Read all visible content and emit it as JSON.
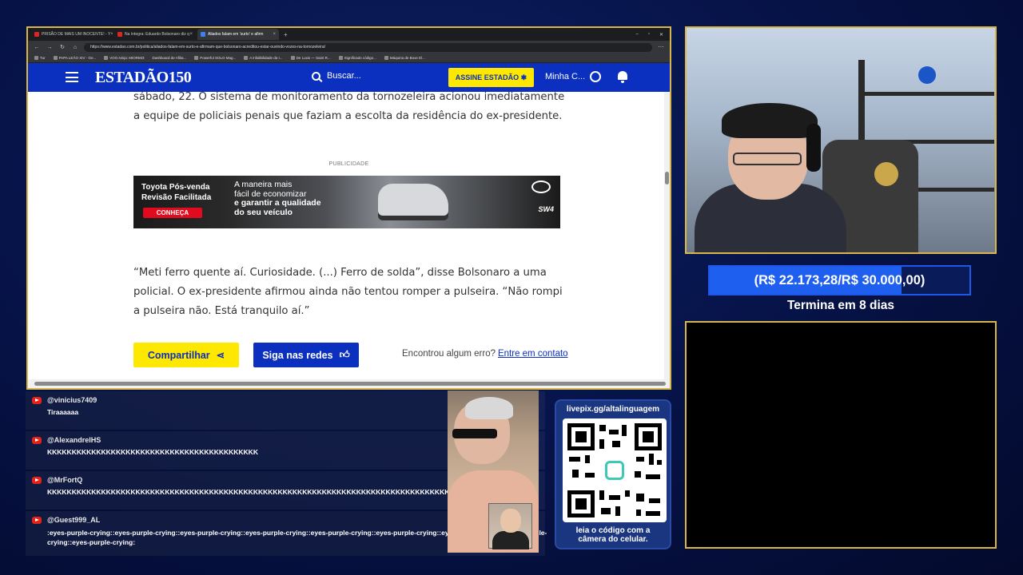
{
  "browser": {
    "tabs": [
      {
        "label": "PRISÃO DE MAIS UM INOCENTE! - Y"
      },
      {
        "label": "Na íntegra: Eduardo Bolsonaro diz q"
      },
      {
        "label": "Aliados falam em 'surto' e afirm",
        "active": true
      }
    ],
    "new_tab": "+",
    "url": "https://www.estadao.com.br/politica/aliados-falam-em-surto-e-afirmam-que-bolsonaro-acreditou-estar-ouvindo-vozes-na-tornozeleira/",
    "bookmarks": [
      "Tur",
      "PAPA LEÃO XIV - Ge...",
      "VOO.Ninja: MIORIM3",
      "Dashboard de Afilia...",
      "Powerful SOLO Mag...",
      "A infalibilidade da I...",
      "De Luxis — Saint R...",
      "Significado código...",
      "Máquina de Boxe El..."
    ]
  },
  "site": {
    "logo": "ESTADÃO150",
    "search_placeholder": "Buscar...",
    "subscribe_label": "ASSINE ESTADÃO ✱",
    "account_label": "Minha C...",
    "paragraph1": "sábado, 22. O sistema de monitoramento da tornozeleira acionou imediatamente a equipe de policiais penais que faziam a escolta da residência do ex-presidente.",
    "ad_label": "PUBLICIDADE",
    "ad": {
      "line1": "Toyota Pós-venda",
      "line2": "Revisão Facilitada",
      "cta": "CONHEÇA",
      "slogan1": "A maneira mais",
      "slogan2": "fácil de economizar",
      "slogan3": "e garantir a qualidade",
      "slogan4": "do seu veículo",
      "model": "SW4"
    },
    "paragraph2": "“Meti ferro quente aí. Curiosidade. (...) Ferro de solda”, disse Bolsonaro a uma policial. O ex-presidente afirmou ainda não tentou romper a pulseira. “Não rompi a pulseira não. Está tranquilo aí.”",
    "share_label": "Compartilhar",
    "follow_label": "Siga nas redes",
    "error_text": "Encontrou algum erro?",
    "contact_link": "Entre em contato"
  },
  "goal": {
    "text": "(R$ 22.173,28/R$ 30.000,00)",
    "progress": 0.739,
    "ends_text": "Termina em 8 dias"
  },
  "chat": [
    {
      "user": "@vinicius7409",
      "text": "Tiraaaaaa"
    },
    {
      "user": "@AlexandreIHS",
      "text": "KKKKKKKKKKKKKKKKKKKKKKKKKKKKKKKKKKKKKKKKKKK"
    },
    {
      "user": "@MrFortQ",
      "text": "KKKKKKKKKKKKKKKKKKKKKKKKKKKKKKKKKKKKKKKKKKKKKKKKKKKKKKKKKKKKKKKKKKKKKKKKKKKKKKKKKKKKKKKKKKKKKKKKKK"
    },
    {
      "user": "@Guest999_AL",
      "text": ":eyes-purple-crying::eyes-purple-crying::eyes-purple-crying::eyes-purple-crying::eyes-purple-crying::eyes-purple-crying::eyes-purple-crying::eyes-purple-crying::eyes-purple-crying:"
    }
  ],
  "pix": {
    "url": "livepix.gg/altalinguagem",
    "caption1": "leia o código com a",
    "caption2": "câmera do celular."
  },
  "colors": {
    "frame": "#d9b64a",
    "brand_blue": "#0b2fbf",
    "brand_yellow": "#ffe800",
    "goal_blue": "#1f5ff0"
  }
}
